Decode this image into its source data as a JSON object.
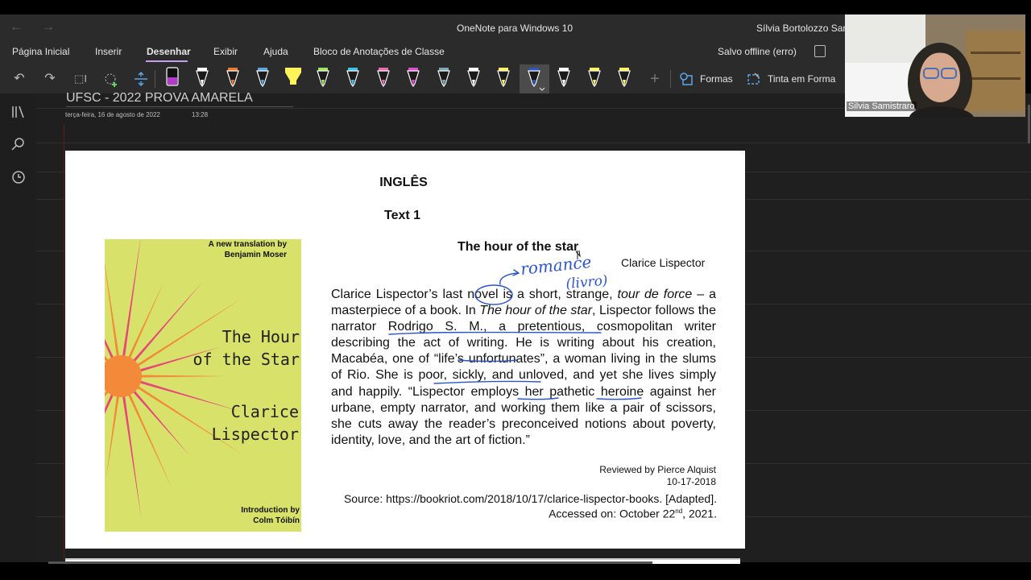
{
  "titlebar": {
    "back_icon": "arrow-left",
    "forward_icon": "arrow-right",
    "app_title": "OneNote para Windows 10",
    "user_name": "Sílvia Bortolozzo San"
  },
  "ribbon": {
    "tabs": [
      {
        "label": "Página Inicial"
      },
      {
        "label": "Inserir"
      },
      {
        "label": "Desenhar",
        "active": true
      },
      {
        "label": "Exibir"
      },
      {
        "label": "Ajuda"
      },
      {
        "label": "Bloco de Anotações de Classe"
      }
    ],
    "sync_status": "Salvo offline (erro)",
    "accent_color": "#c79be6"
  },
  "toolbar": {
    "tools": [
      "undo-icon",
      "redo-icon",
      "select-text-icon",
      "lasso-icon",
      "insert-space-icon"
    ],
    "pens": [
      {
        "kind": "eraser",
        "color": "#b23cc9"
      },
      {
        "kind": "pen",
        "color": "#ffffff"
      },
      {
        "kind": "pen",
        "color": "#f07a2a"
      },
      {
        "kind": "pen",
        "color": "#5aa7e8"
      },
      {
        "kind": "highlighter",
        "color": "#fff35a"
      },
      {
        "kind": "pen",
        "color": "#9ee65a"
      },
      {
        "kind": "pen",
        "color": "#3ac4ef"
      },
      {
        "kind": "pen",
        "color": "#f06ab0"
      },
      {
        "kind": "pen",
        "color": "#e34bd5"
      },
      {
        "kind": "pen",
        "color": "#7fa9b8"
      },
      {
        "kind": "pen",
        "color": "#ffffff"
      },
      {
        "kind": "pen",
        "color": "#fff35a"
      },
      {
        "kind": "pen",
        "color": "#2c55c9",
        "selected": true
      },
      {
        "kind": "pen",
        "color": "#ffffff"
      },
      {
        "kind": "pen",
        "color": "#fff35a"
      },
      {
        "kind": "pen",
        "color": "#fff35a"
      }
    ],
    "add_pen_icon": "plus-icon",
    "shapes_label": "Formas",
    "ink_to_shape_label": "Tinta em Forma"
  },
  "sidebar": {
    "icons": [
      "notebooks-icon",
      "search-icon",
      "recent-icon"
    ]
  },
  "page": {
    "title": "UFSC - 2022 PROVA AMARELA",
    "date": "terça-feira, 16 de agosto de 2022",
    "time": "13:28"
  },
  "document": {
    "heading": "INGLÊS",
    "text_label": "Text 1",
    "book_cover": {
      "top_right": "A new translation by Benjamin Moser",
      "title": "The Hour\nof the Star",
      "author": "Clarice\nLispector",
      "bottom_right": "Introduction by Colm Tóibín",
      "bg_color": "#d8e26a",
      "burst_colors": [
        "#f28a3a",
        "#e8457a"
      ]
    },
    "story_title": "The hour of the star",
    "story_author": "Clarice Lispector",
    "paragraph": [
      {
        "t": "Clarice Lispector’s last "
      },
      {
        "t": "novel",
        "mark": "circle"
      },
      {
        "t": " is a short, strange, "
      },
      {
        "t": "tour de force",
        "style": "italic"
      },
      {
        "t": " – a masterpiece of a book. In "
      },
      {
        "t": "The hour of the star",
        "style": "italic"
      },
      {
        "t": ", Lispector follows the narrator Rodrigo S. M., a pretentious, cosmopolitan writer describing the act of writing. He is writing about his creation, Macabéa, one of “life’s unfortunates”, a woman living in the slums of Rio. She is poor, sickly, and unloved, and yet she lives simply and happily. “Lispector employs her pathetic heroine against her urbane, empty narrator, and working them like a pair of scissors, she cuts away the reader’s preconceived notions about poverty, identity, love, and the art of fiction.”"
      }
    ],
    "reviewed_by": "Reviewed by Pierce Alquist",
    "review_date": "10-17-2018",
    "source_line1": "Source: https://bookriot.com/2018/10/17/clarice-lispector-books. [Adapted].",
    "source_line2_prefix": "Accessed on: October 22",
    "source_line2_sup": "nd",
    "source_line2_suffix": ", 2021.",
    "ink_annotations": [
      "romance",
      "(livro)"
    ],
    "ink_color": "#2c55c9"
  },
  "webcam": {
    "participant_name": "Silvia Samistraro"
  }
}
